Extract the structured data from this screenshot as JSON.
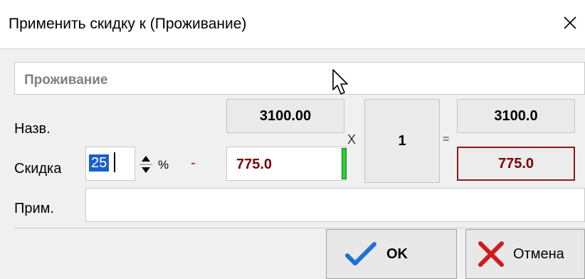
{
  "window": {
    "title": "Применить скидку к (Проживание)"
  },
  "form": {
    "name_value": "Проживание",
    "labels": {
      "name": "Назв.",
      "discount": "Скидка",
      "note": "Прим."
    },
    "percent_value": "25",
    "percent_sign": "%",
    "minus_sign": "-",
    "price": "3100.00",
    "discount_amount": "775.0",
    "multiply_sign": "X",
    "quantity": "1",
    "equals_sign": "=",
    "total": "3100.0",
    "total_discount": "775.0",
    "note_value": ""
  },
  "buttons": {
    "ok": "OK",
    "cancel": "Отмена"
  },
  "colors": {
    "accent_red": "#7a0000",
    "selection_blue": "#1a5fcb",
    "indicator_green": "#2ecc40",
    "ok_check_blue": "#1e72d6",
    "cancel_x_red": "#d11a1a"
  }
}
